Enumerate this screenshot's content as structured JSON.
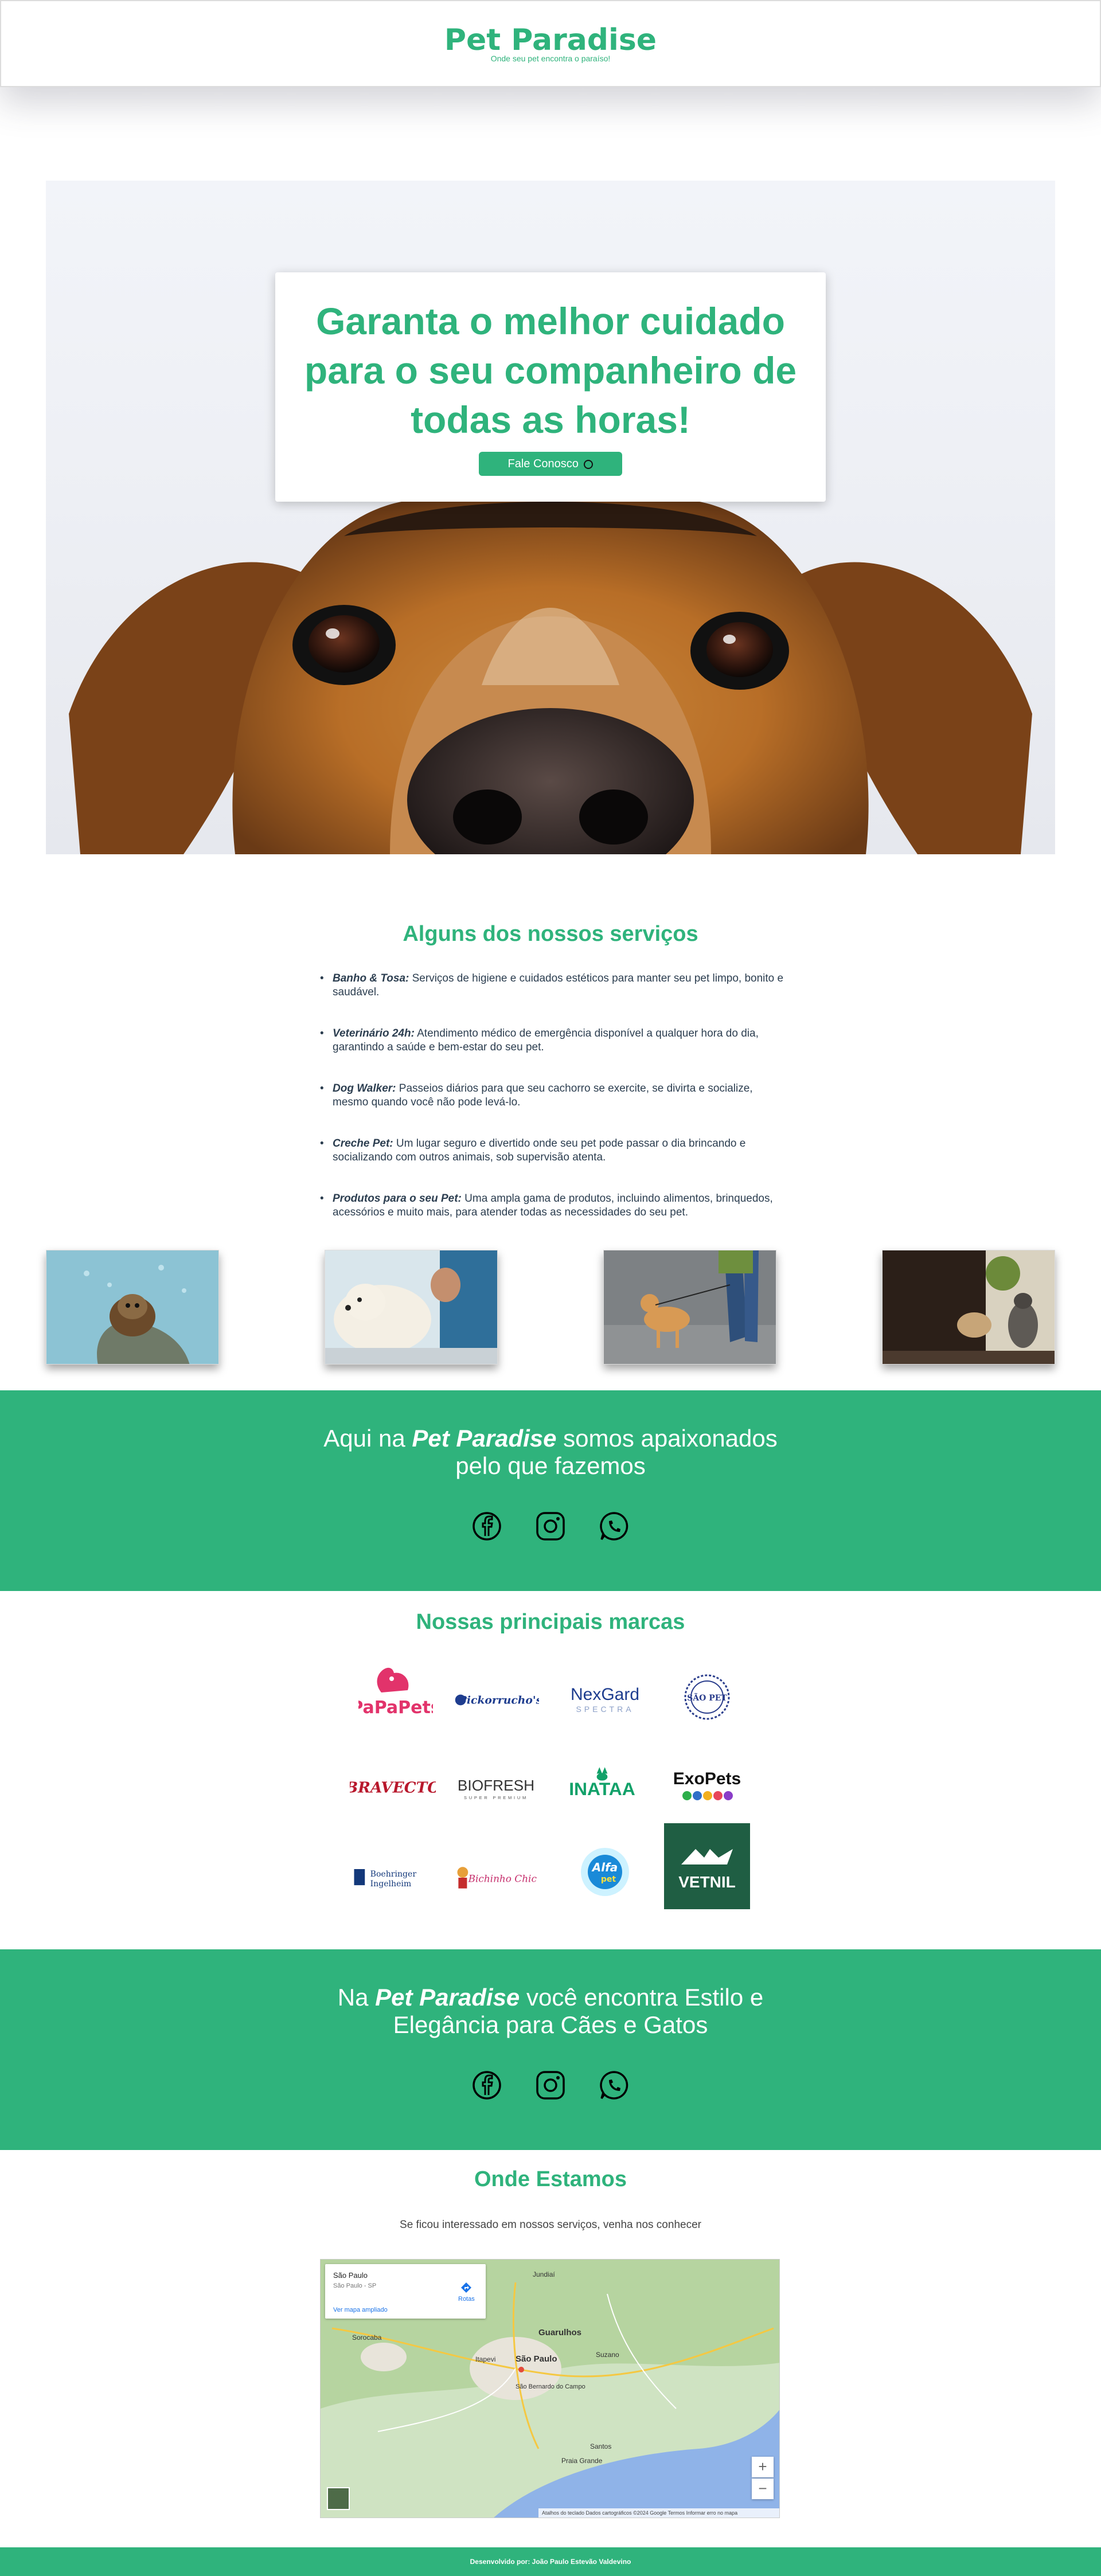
{
  "header": {
    "brand": "Pet Paradise",
    "tagline": "Onde seu pet encontra o paraíso!"
  },
  "hero": {
    "title": "Garanta o melhor cuidado para o seu companheiro de todas as horas!",
    "cta_label": "Fale Conosco",
    "cta_icon": "whatsapp-icon"
  },
  "services": {
    "title": "Alguns dos nossos serviços",
    "items": [
      {
        "name": "Banho & Tosa:",
        "desc": " Serviços de higiene e cuidados estéticos para manter seu pet limpo, bonito e saudável."
      },
      {
        "name": "Veterinário 24h:",
        "desc": " Atendimento médico de emergência disponível a qualquer hora do dia, garantindo a saúde e bem-estar do seu pet."
      },
      {
        "name": "Dog Walker:",
        "desc": " Passeios diários para que seu cachorro se exercite, se divirta e socialize, mesmo quando você não pode levá-lo."
      },
      {
        "name": "Creche Pet:",
        "desc": " Um lugar seguro e divertido onde seu pet pode passar o dia brincando e socializando com outros animais, sob supervisão atenta."
      },
      {
        "name": "Produtos para o seu Pet:",
        "desc": " Uma ampla gama de produtos, incluindo alimentos, brinquedos, acessórios e muito mais, para atender todas as necessidades do seu pet."
      }
    ]
  },
  "banner1": {
    "pre": "Aqui na ",
    "brand": "Pet Paradise",
    "post": " somos apaixonados pelo que fazemos"
  },
  "banner2": {
    "pre": "Na ",
    "brand": "Pet Paradise",
    "post": " você encontra Estilo e Elegância para Cães e Gatos"
  },
  "socials": [
    "facebook-icon",
    "instagram-icon",
    "whatsapp-icon"
  ],
  "brands": {
    "title": "Nossas principais marcas",
    "items": [
      "PaPaPets",
      "Pickorrucho's",
      "NexGard SPECTRA",
      "SÃO PET",
      "BRAVECTO",
      "BIOFRESH",
      "INATAA",
      "ExoPets",
      "Boehringer Ingelheim",
      "Bichinho Chic",
      "Alfa pet",
      "VETNIL"
    ]
  },
  "location": {
    "title": "Onde Estamos",
    "subtitle": "Se ficou interessado em nossos serviços, venha nos conhecer",
    "map": {
      "place": "São Paulo",
      "address": "São Paulo - SP",
      "link": "Ver mapa ampliado",
      "route": "Rotas",
      "labels": [
        "Guarulhos",
        "São Paulo",
        "Sorocaba",
        "Santos",
        "Praia Grande",
        "São Bernardo do Campo",
        "Suzano",
        "Itapevi",
        "Jundiaí"
      ],
      "attribution": "Atalhos do teclado   Dados cartográficos ©2024 Google   Termos   Informar erro no mapa"
    }
  },
  "footer": {
    "text": "Desenvolvido por: João Paulo Estevão Valdevino"
  },
  "colors": {
    "accent": "#2fb37c",
    "text": "#2c3e50"
  }
}
